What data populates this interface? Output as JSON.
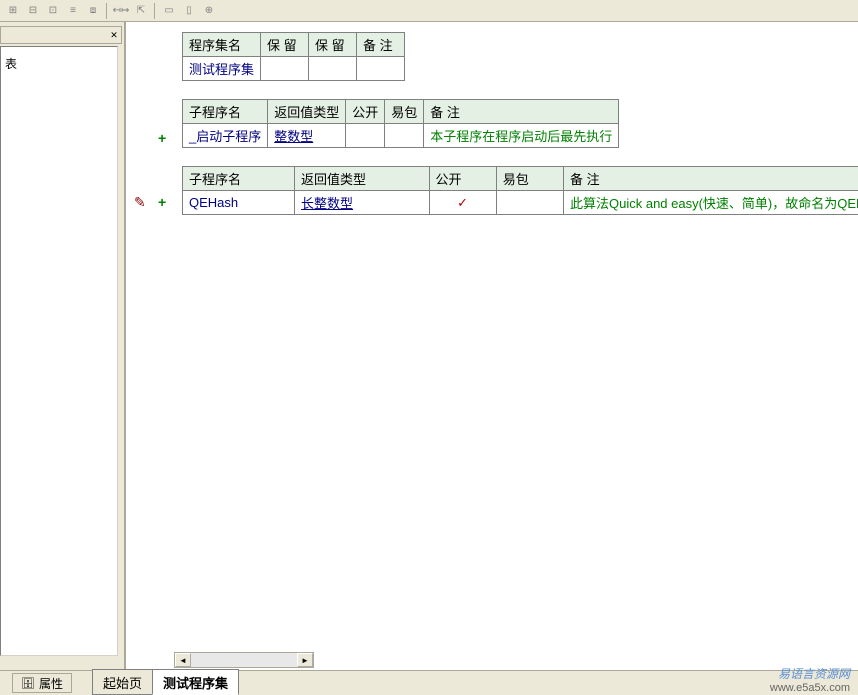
{
  "left_panel": {
    "title": "",
    "body_text": "表"
  },
  "table1": {
    "headers": [
      "程序集名",
      "保 留",
      "保 留",
      "备 注"
    ],
    "row": {
      "name": "测试程序集",
      "c2": "",
      "c3": "",
      "c4": ""
    }
  },
  "table2": {
    "headers": [
      "子程序名",
      "返回值类型",
      "公开",
      "易包",
      "备 注"
    ],
    "row": {
      "name": "_启动子程序",
      "ret": "整数型",
      "pub": "",
      "pkg": "",
      "rem": "本子程序在程序启动后最先执行"
    }
  },
  "table3": {
    "headers": [
      "子程序名",
      "返回值类型",
      "公开",
      "易包",
      "备 注"
    ],
    "row": {
      "name": "QEHash",
      "ret": "长整数型",
      "pub": "✓",
      "pkg": "",
      "rem": "此算法Quick and easy(快速、简单)，故命名为QEHash。－－By"
    }
  },
  "bottom": {
    "properties": "属性",
    "tab_start": "起始页",
    "tab_test": "测试程序集"
  },
  "watermark": {
    "line1": "易语言资源网",
    "line2": "www.e5a5x.com"
  }
}
